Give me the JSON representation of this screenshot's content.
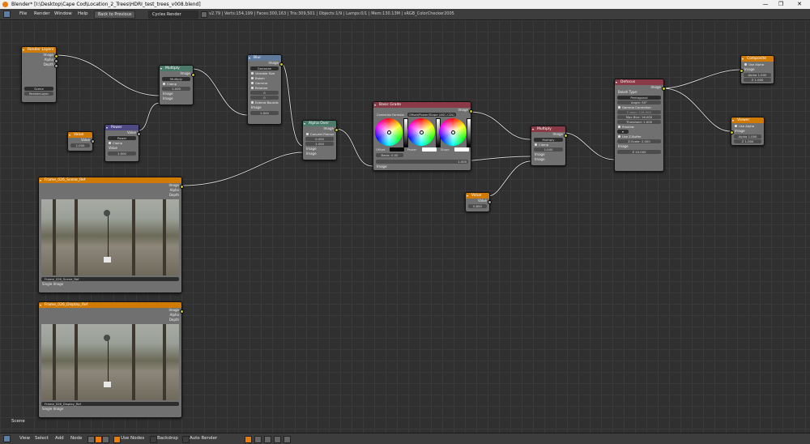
{
  "window": {
    "title": "Blender* [I:\\Desktop\\Cape Cod\\Location_2_Trees\\HDRI_test_trees_v008.blend]",
    "minimize": "—",
    "maximize": "❐",
    "close": "✕"
  },
  "menubar": {
    "items": [
      "File",
      "Render",
      "Window",
      "Help"
    ],
    "back_button": "Back to Previous",
    "engine": "Cycles Render",
    "stats": "v2.79 | Verts:154,199 | Faces:300,163 | Tris:309,501 | Objects:1/9 | Lamps:0/1 | Mem:130.13M | sRGB_ColorChecker2005"
  },
  "nodes": {
    "render_layers": {
      "title": "Render Layers",
      "outputs": [
        "Image",
        "Alpha",
        "Depth"
      ],
      "scene": "Scene",
      "layer": "RenderLayer"
    },
    "value1": {
      "title": "Value",
      "output": "Value",
      "value": "1.000"
    },
    "power": {
      "title": "Power",
      "output": "Value",
      "op": "Power",
      "clamp": "Clamp",
      "in1": "Value",
      "in2": "Value",
      "in2_val": "1.000"
    },
    "multiply1": {
      "title": "Multiply",
      "output": "Image",
      "mode": "Multiply",
      "clamp": "Clamp",
      "fac": "Fac",
      "fac_val": "1.000",
      "in1": "Image",
      "in2": "Image"
    },
    "blur": {
      "title": "Blur",
      "output": "Image",
      "filter": "Gaussian",
      "opts": [
        "Variable Size",
        "Bokeh",
        "Gamma",
        "Relative"
      ],
      "x": "X:",
      "x_val": "0",
      "y": "Y:",
      "y_val": "0",
      "extend": "Extend Bounds",
      "in": "Image",
      "size": "Size",
      "size_val": "1.000"
    },
    "alpha_over": {
      "title": "Alpha Over",
      "output": "Image",
      "convert": "Convert Premul",
      "premul": "Premul:",
      "premul_val": "0.000",
      "fac": "Fac",
      "fac_val": "1.000",
      "in1": "Image",
      "in2": "Image"
    },
    "color_balance": {
      "title": "Basic Grade",
      "output": "Image",
      "formula": "Correction Formula:",
      "formula_val": "Offset/Power/Slope (ASC-CDL)",
      "offset": "Offset",
      "power": "Power",
      "slope": "Slope",
      "basis": "Basis:",
      "basis_val": "0.00",
      "fac": "Fac",
      "fac_val": "1.000",
      "in": "Image"
    },
    "multiply2": {
      "title": "Multiply",
      "output": "Image",
      "mode": "Multiply",
      "clamp": "Clamp",
      "fac": "Fac",
      "fac_val": "1.000",
      "in1": "Image",
      "in2": "Image"
    },
    "value2": {
      "title": "Value",
      "output": "Value",
      "value": "0.850"
    },
    "defocus": {
      "title": "Defocus",
      "output": "Image",
      "bokeh": "Bokeh Type:",
      "bokeh_val": "Pentagonal",
      "angle": "Angle:",
      "angle_val": "50°",
      "gamma": "Gamma Correction",
      "fstop": "F-stop:",
      "fstop_val": "128.000",
      "maxblur": "Max Blur:",
      "maxblur_val": "16.000",
      "threshold": "Threshold:",
      "threshold_val": "1.000",
      "preview": "Preview",
      "scene": "Scene",
      "zbuffer": "Use Z-Buffer",
      "zscale": "Z-Scale:",
      "zscale_val": "2.000",
      "in": "Image",
      "z": "Z",
      "z_val": "10.000"
    },
    "composite": {
      "title": "Composite",
      "use_alpha": "Use Alpha",
      "in1": "Image",
      "in2": "Alpha",
      "in2_val": "1.000",
      "in3": "Z",
      "in3_val": "1.000"
    },
    "viewer": {
      "title": "Viewer",
      "use_alpha": "Use Alpha",
      "in1": "Image",
      "in2": "Alpha",
      "in2_val": "1.000",
      "in3": "Z",
      "in3_val": "1.000"
    },
    "image1": {
      "title": "Frame_026_Scene_Ref",
      "outputs": [
        "Image",
        "Alpha",
        "Depth"
      ],
      "file": "Frame_026_Scene_Ref",
      "source": "Single Image"
    },
    "image2": {
      "title": "Frame_026_Display_Ref",
      "outputs": [
        "Image",
        "Alpha",
        "Depth"
      ],
      "file": "Frame_026_Display_Ref",
      "source": "Single Image"
    }
  },
  "scene_label": "Scene",
  "statusbar": {
    "items": [
      "View",
      "Select",
      "Add",
      "Node"
    ],
    "use_nodes": "Use Nodes",
    "backdrop": "Backdrop",
    "auto_render": "Auto Render"
  },
  "colors": {
    "input_header": "#d07a06",
    "color_header": "#4a7a6a",
    "converter_header": "#4d4a83",
    "distort_header": "#8a3a46",
    "editor_bg": "#303030"
  }
}
